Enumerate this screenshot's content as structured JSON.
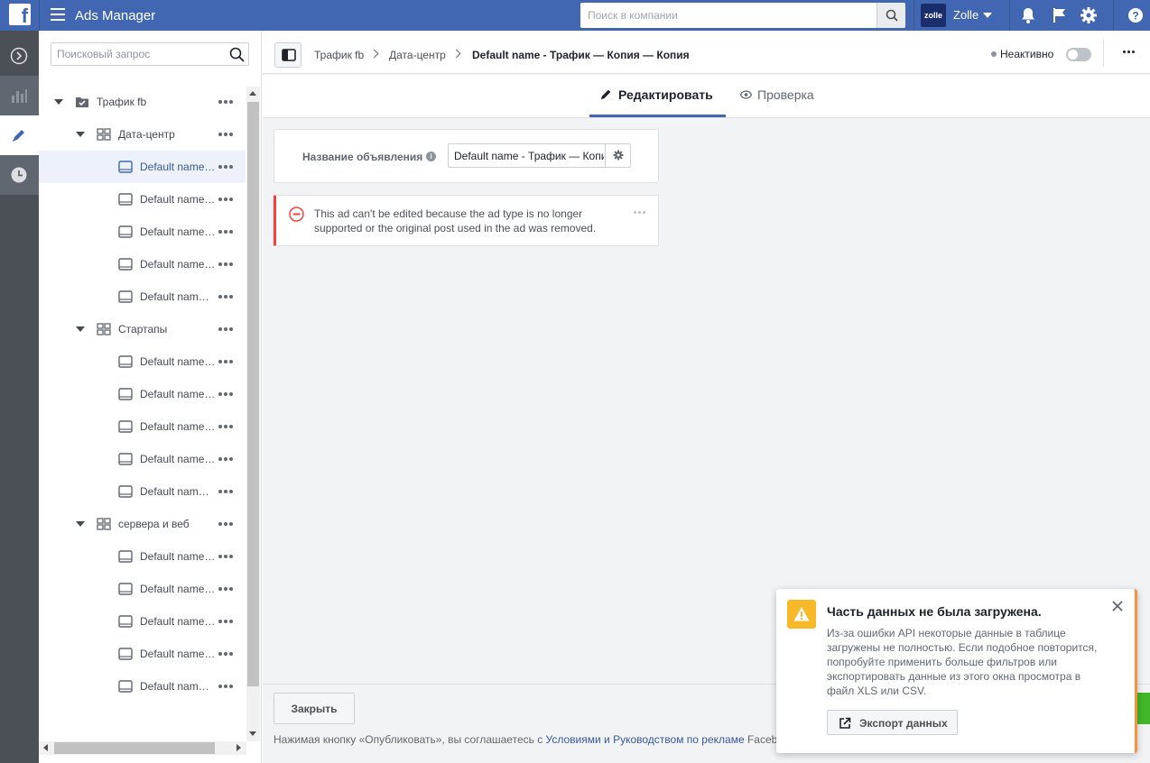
{
  "topbar": {
    "app_title": "Ads Manager",
    "search_placeholder": "Поиск в компании",
    "account_logo_text": "zolle",
    "account_name": "Zolle",
    "brand_color": "#4267b2"
  },
  "rail": {
    "items": [
      "expand-icon",
      "reports-icon",
      "edit-icon",
      "history-icon"
    ],
    "active": "edit-icon"
  },
  "tree": {
    "search_placeholder": "Поисковый запрос",
    "campaign": "Трафик fb",
    "adsets": [
      {
        "name": "Дата-центр",
        "ads": [
          "Default name…",
          "Default name…",
          "Default name…",
          "Default name…",
          "Default nam…"
        ]
      },
      {
        "name": "Стартапы",
        "ads": [
          "Default name…",
          "Default name…",
          "Default name…",
          "Default name…",
          "Default nam…"
        ]
      },
      {
        "name": "сервера и веб",
        "ads": [
          "Default name…",
          "Default name…",
          "Default name…",
          "Default name…",
          "Default nam…"
        ]
      }
    ]
  },
  "breadcrumb": {
    "items": [
      "Трафик fb",
      "Дата-центр",
      "Default name - Трафик — Копия — Копия"
    ],
    "status": "Неактивно"
  },
  "tabs": {
    "edit": "Редактировать",
    "review": "Проверка"
  },
  "ad_name": {
    "label": "Название объявления",
    "value": "Default name - Трафик — Копия — Копия"
  },
  "error": {
    "message": "This ad can't be edited because the ad type is no longer supported or the original post used in the ad was removed."
  },
  "footer": {
    "close_label": "Закрыть",
    "terms_prefix": "Нажимая кнопку «Опубликовать», вы соглашаетесь с ",
    "terms_link": "Условиями и Руководством по рекламе",
    "terms_suffix": " Facebook."
  },
  "toast": {
    "title": "Часть данных не была загружена.",
    "body": "Из-за ошибки API некоторые данные в таблице загружены не полностью. Если подобное повторится, попробуйте применить больше фильтров или экспортировать данные из этого окна просмотра в файл XLS или CSV.",
    "export_label": "Экспорт данных"
  }
}
